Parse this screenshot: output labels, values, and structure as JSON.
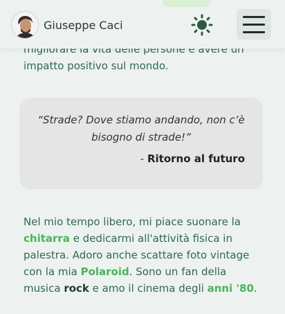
{
  "header": {
    "name": "Giuseppe Caci",
    "avatar_icon": "avatar-portrait",
    "theme_icon": "sun-icon",
    "menu_icon": "hamburger-menu-icon"
  },
  "intro": {
    "line1": "migliorare la vita delle persone e avere un",
    "line2": "impatto positivo sul mondo."
  },
  "quote": {
    "text": "“Strade? Dove stiamo andando, non c’è bisogno di strade!”",
    "dash": "- ",
    "source": "Ritorno al futuro"
  },
  "hobbies": {
    "t1": "Nel mio tempo libero, mi piace suonare la ",
    "guitar": "chitarra",
    "t2": " e dedicarmi all'attività fisica in palestra. Adoro anche scattare foto vintage con la mia ",
    "polaroid": "Polaroid",
    "t3": ". Sono un fan della musica ",
    "rock": "rock",
    "t4": " e amo il cinema degli ",
    "eighties": "anni '80",
    "t5": "."
  },
  "colors": {
    "background": "#edf2f0",
    "text_green": "#2f6a4a",
    "accent_green": "#48b55c",
    "quote_bg": "#e5e5e5"
  }
}
